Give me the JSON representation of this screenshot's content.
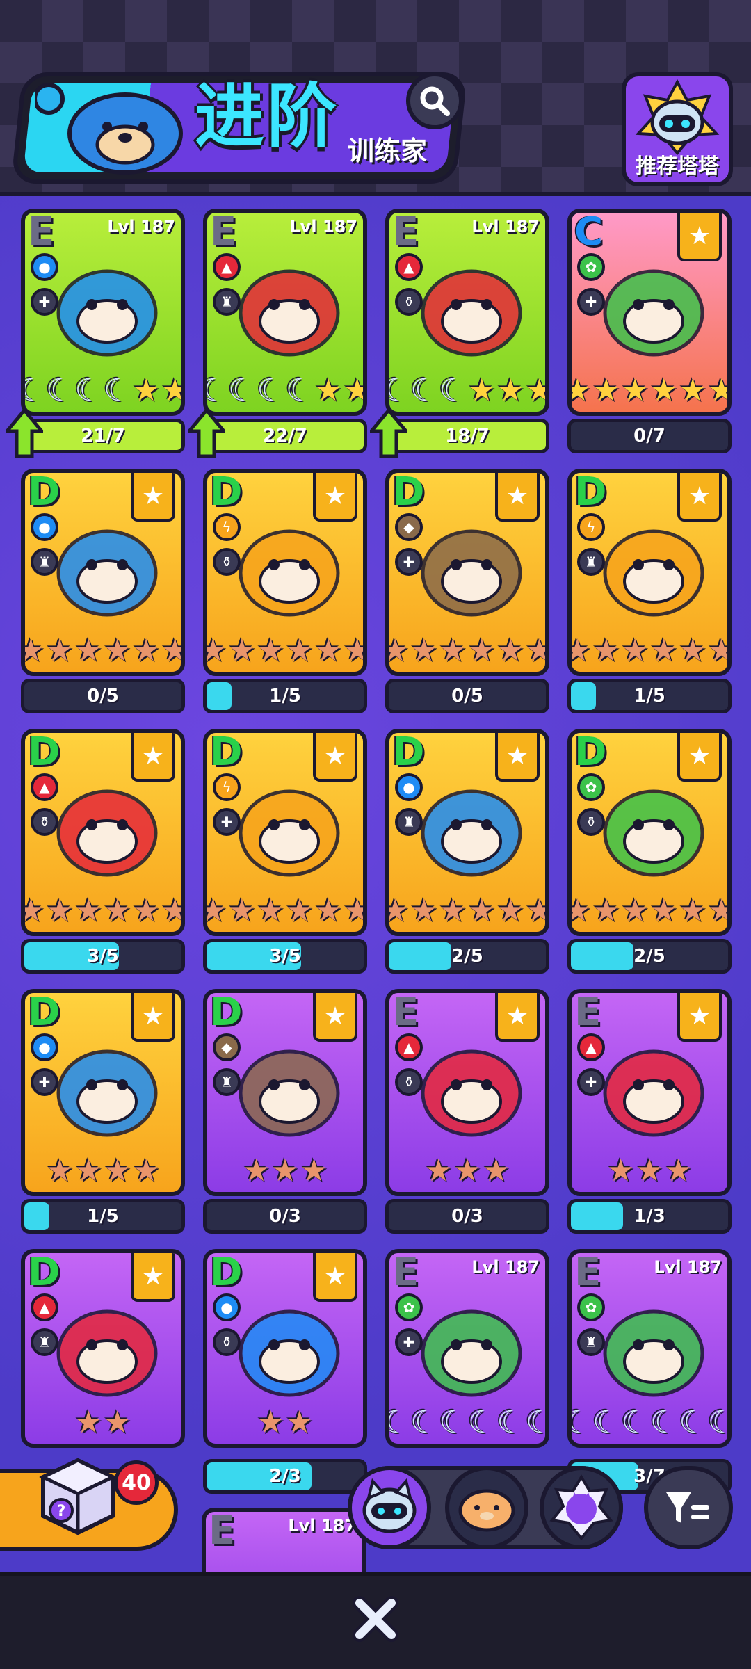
{
  "header": {
    "title": "进阶",
    "subtitle": "训练家",
    "recommend_label": "推荐塔塔"
  },
  "cards": [
    {
      "rank": "E",
      "level": "Lvl 187",
      "bg": "green",
      "element": "water",
      "stars": "mmmmgg",
      "progress_text": "21/7",
      "progress": 1,
      "upgradable": true
    },
    {
      "rank": "E",
      "level": "Lvl 187",
      "bg": "green",
      "element": "fire",
      "stars": "mmmmgg",
      "progress_text": "22/7",
      "progress": 1,
      "upgradable": true
    },
    {
      "rank": "E",
      "level": "Lvl 187",
      "bg": "green",
      "element": "fire",
      "stars": "mmmggg",
      "progress_text": "18/7",
      "progress": 1,
      "upgradable": true
    },
    {
      "rank": "C",
      "level": "",
      "bg": "pink",
      "element": "leaf",
      "stars": "gggggg",
      "progress_text": "0/7",
      "progress": 0,
      "upgradable": false
    },
    {
      "rank": "D",
      "level": "",
      "bg": "gold",
      "element": "water",
      "stars": "bbbbbb",
      "progress_text": "0/5",
      "progress": 0
    },
    {
      "rank": "D",
      "level": "",
      "bg": "gold",
      "element": "bolt",
      "stars": "bbbbbb",
      "progress_text": "1/5",
      "progress": 0.2
    },
    {
      "rank": "D",
      "level": "",
      "bg": "gold",
      "element": "earth",
      "stars": "bbbbbb",
      "progress_text": "0/5",
      "progress": 0
    },
    {
      "rank": "D",
      "level": "",
      "bg": "gold",
      "element": "bolt",
      "stars": "bbbbbb",
      "progress_text": "1/5",
      "progress": 0.2
    },
    {
      "rank": "D",
      "level": "",
      "bg": "gold",
      "element": "fire",
      "stars": "bbbbbb",
      "progress_text": "3/5",
      "progress": 0.6
    },
    {
      "rank": "D",
      "level": "",
      "bg": "gold",
      "element": "bolt",
      "stars": "bbbbbb",
      "progress_text": "3/5",
      "progress": 0.6
    },
    {
      "rank": "D",
      "level": "",
      "bg": "gold",
      "element": "water",
      "stars": "bbbbbb",
      "progress_text": "2/5",
      "progress": 0.4
    },
    {
      "rank": "D",
      "level": "",
      "bg": "gold",
      "element": "leaf",
      "stars": "bbbbbb",
      "progress_text": "2/5",
      "progress": 0.4
    },
    {
      "rank": "D",
      "level": "",
      "bg": "gold",
      "element": "water",
      "stars": "bbbb",
      "progress_text": "1/5",
      "progress": 0.2
    },
    {
      "rank": "D",
      "level": "",
      "bg": "purple",
      "element": "earth",
      "stars": "bbb",
      "progress_text": "0/3",
      "progress": 0
    },
    {
      "rank": "E",
      "level": "",
      "bg": "purple",
      "element": "fire",
      "stars": "bbb",
      "progress_text": "0/3",
      "progress": 0
    },
    {
      "rank": "E",
      "level": "",
      "bg": "purple",
      "element": "fire",
      "stars": "bbb",
      "progress_text": "1/3",
      "progress": 0.33
    },
    {
      "rank": "D",
      "level": "",
      "bg": "purple",
      "element": "fire",
      "stars": "bb",
      "progress_text": "",
      "progress": 0
    },
    {
      "rank": "D",
      "level": "",
      "bg": "purple",
      "element": "water",
      "stars": "bb",
      "progress_text": "2/3",
      "progress": 0.67
    },
    {
      "rank": "E",
      "level": "Lvl 187",
      "bg": "purple",
      "element": "leaf",
      "stars": "mmmmmm",
      "progress_text": "",
      "progress": 0
    },
    {
      "rank": "E",
      "level": "Lvl 187",
      "bg": "purple",
      "element": "leaf",
      "stars": "mmmmmm",
      "progress_text": "3/7",
      "progress": 0.43
    }
  ],
  "partial_row": [
    {
      "rank": "E",
      "level": "Lvl 187"
    }
  ],
  "mystery_box": {
    "count": "40"
  },
  "colors": {
    "water": "#1e8cf5",
    "fire": "#e5283a",
    "leaf": "#3cc24a",
    "bolt": "#f7a41c",
    "earth": "#8a6a4a",
    "progress_fill": "#3ad8ee"
  },
  "icons": {
    "search": "search-icon",
    "close": "close-icon",
    "filter": "filter-icon",
    "tab1": "cat-robot-icon",
    "tab2": "hamster-icon",
    "tab3": "purple-cat-badge-icon"
  }
}
